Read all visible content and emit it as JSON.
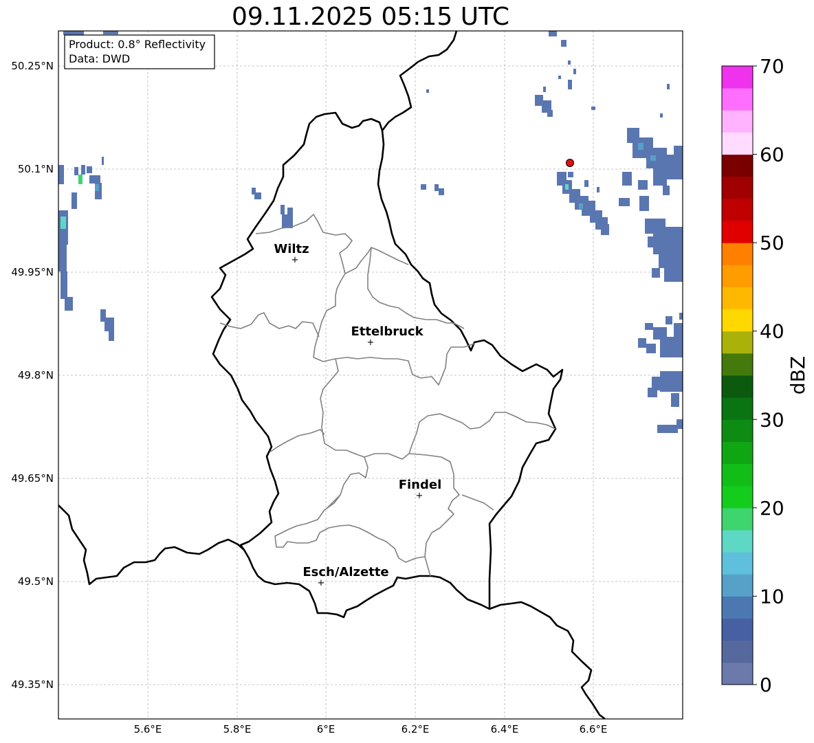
{
  "title": "09.11.2025 05:15 UTC",
  "info_box": {
    "product": "Product: 0.8° Reflectivity",
    "data": "Data: DWD"
  },
  "axes": {
    "lat_ticks": [
      "50.25°N",
      "50.1°N",
      "49.95°N",
      "49.8°N",
      "49.65°N",
      "49.5°N",
      "49.35°N"
    ],
    "lon_ticks": [
      "5.6°E",
      "5.8°E",
      "6°E",
      "6.2°E",
      "6.4°E",
      "6.6°E"
    ],
    "grid": true
  },
  "cities": [
    {
      "name": "Wiltz"
    },
    {
      "name": "Ettelbruck"
    },
    {
      "name": "Findel"
    },
    {
      "name": "Esch/Alzette"
    }
  ],
  "radar_site_color": "#e01010",
  "colorbar": {
    "unit": "dBZ",
    "ticks": [
      "0",
      "10",
      "20",
      "30",
      "40",
      "50",
      "60",
      "70"
    ],
    "colors": [
      "#6b7aab",
      "#55699f",
      "#4760a3",
      "#4b78b1",
      "#57a0c8",
      "#5ec0dc",
      "#5fd7c5",
      "#3ed46e",
      "#14cc1c",
      "#12bd18",
      "#10a513",
      "#0e8b13",
      "#0a7412",
      "#0b5a0e",
      "#437a0b",
      "#aab20a",
      "#ffd800",
      "#ffb800",
      "#ff9c00",
      "#ff7f00",
      "#e00000",
      "#c00000",
      "#a00000",
      "#7a0000",
      "#ffdcff",
      "#ffb3ff",
      "#ff6eff",
      "#ee32ee"
    ]
  }
}
